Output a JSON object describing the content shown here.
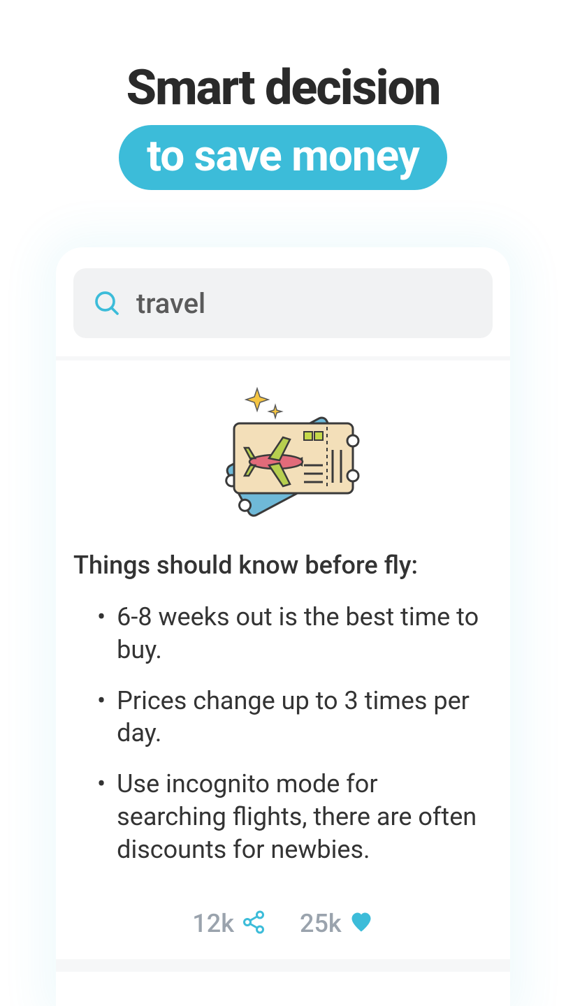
{
  "hero": {
    "line1": "Smart decision",
    "line2": "to save money"
  },
  "search": {
    "value": "travel"
  },
  "content": {
    "title": "Things should know before fly:",
    "tips": [
      "6-8 weeks out is the best time to buy.",
      "Prices change up to 3 times per day.",
      "Use incognito mode for searching flights, there are often discounts for newbies."
    ]
  },
  "actions": {
    "share_count": "12k",
    "like_count": "25k"
  },
  "colors": {
    "accent": "#3cbcd9",
    "heart": "#3cbcd9",
    "share": "#3cbcd9"
  }
}
